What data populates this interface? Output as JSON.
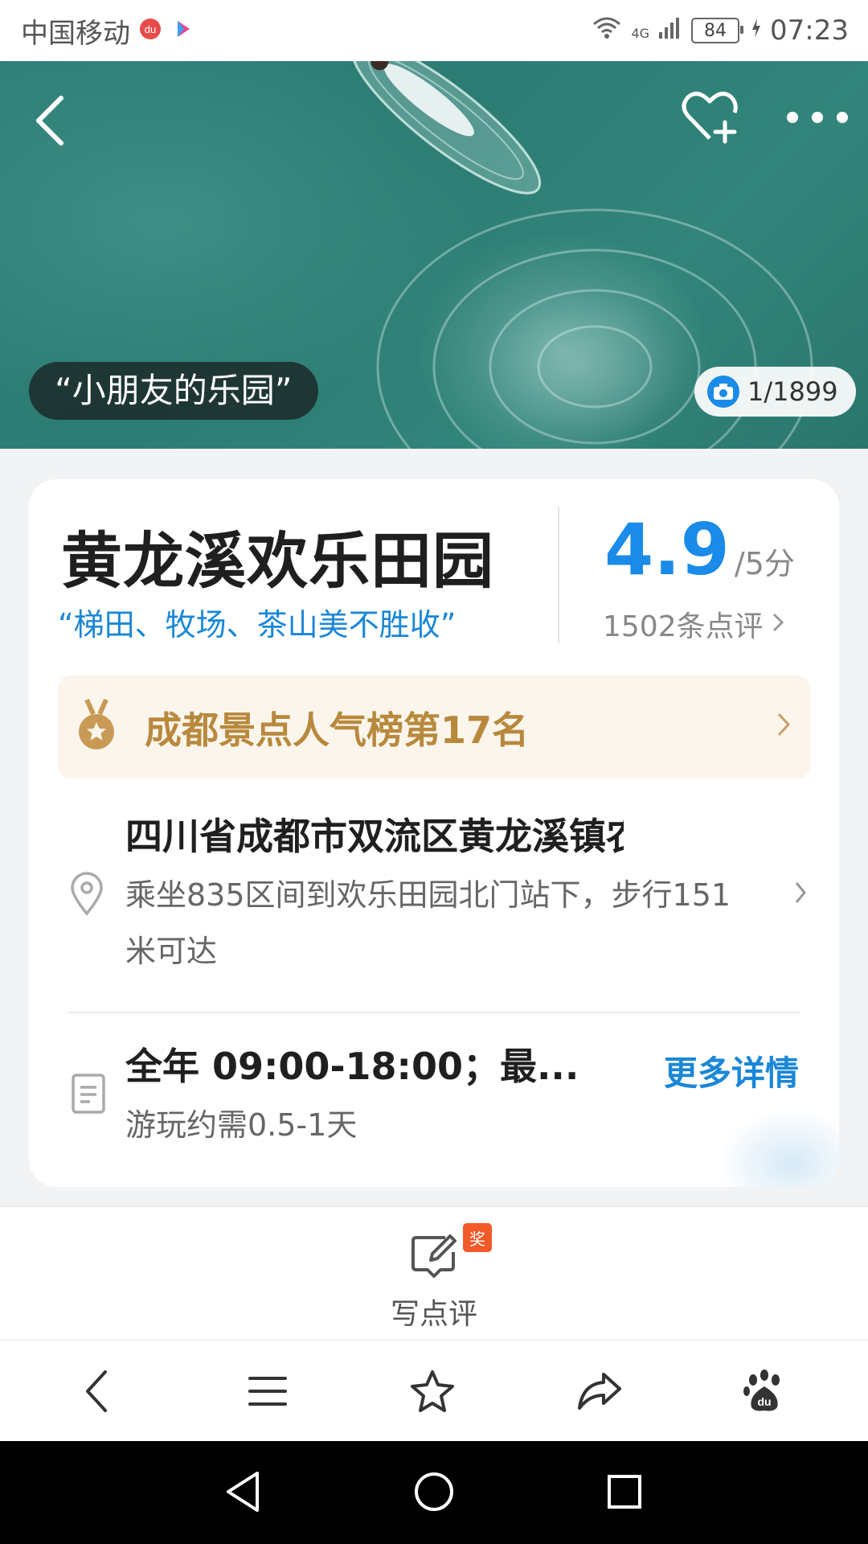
{
  "status_bar": {
    "carrier": "中国移动",
    "network": "4G",
    "battery": "84",
    "time": "07:23"
  },
  "hero": {
    "caption": "“小朋友的乐园”",
    "photo_counter": "1/1899",
    "icons": [
      "back-icon",
      "favorite-add-icon",
      "more-icon",
      "camera-icon"
    ]
  },
  "poi": {
    "name": "黄龙溪欢乐田园",
    "tagline": "“梯田、牧场、茶山美不胜收”",
    "rating": "4.9",
    "rating_unit": "/5分",
    "review_count": "1502条点评",
    "rank": "成都景点人气榜第17名",
    "address": "四川省成都市双流区黄龙溪镇农...",
    "transit": "乘坐835区间到欢乐田园北门站下，步行151米可达",
    "hours": "全年 09:00-18:00；最...",
    "duration": "游玩约需0.5-1天",
    "more_details": "更多详情"
  },
  "review_bar": {
    "write_label": "写点评",
    "badge": "奖"
  },
  "colors": {
    "accent": "#1a8be8",
    "link": "#1a87d6",
    "rank_text": "#b8893d",
    "rank_bg": "#fbf5ec",
    "badge": "#f25a2a"
  },
  "browser_toolbar": [
    "back-icon",
    "menu-icon",
    "star-icon",
    "share-icon",
    "baidu-paw-icon"
  ],
  "android_nav": [
    "nav-back-icon",
    "nav-home-icon",
    "nav-recents-icon"
  ]
}
